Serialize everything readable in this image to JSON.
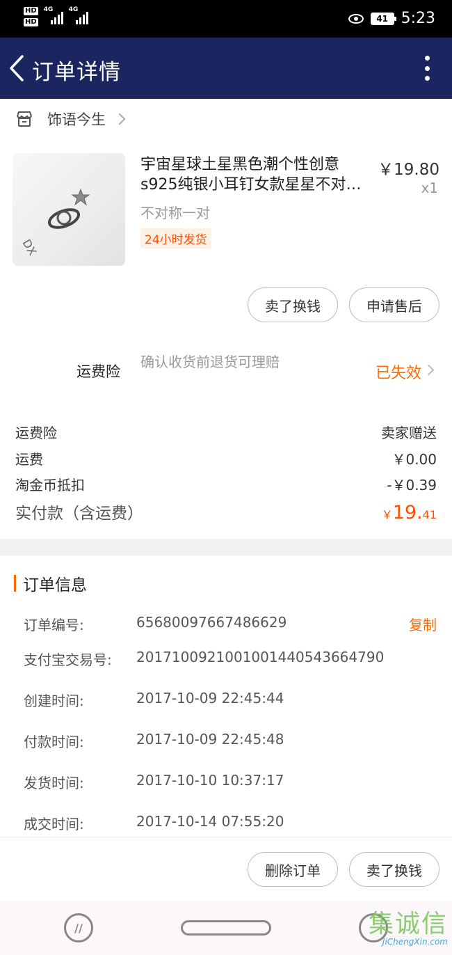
{
  "status_bar": {
    "hd_badges": [
      "HD",
      "HD"
    ],
    "network1": "4G",
    "network2": "4G",
    "battery": "41",
    "time": "5:23"
  },
  "header": {
    "title": "订单详情"
  },
  "shop": {
    "name": "饰语今生"
  },
  "product": {
    "title_line1": "宇宙星球土星黑色潮个性创意",
    "title_line2": "s925纯银小耳钉女款星星不对…",
    "price": "￥19.80",
    "quantity": "x1",
    "sku": "不对称一对",
    "tag": "24小时发货"
  },
  "product_actions": {
    "sell_label": "卖了换钱",
    "after_sale_label": "申请售后"
  },
  "insurance": {
    "label": "运费险",
    "description": "确认收货前退货可理赔",
    "status": "已失效"
  },
  "fees": [
    {
      "label": "运费险",
      "value": "卖家赠送"
    },
    {
      "label": "运费",
      "value": "￥0.00"
    },
    {
      "label": "淘金币抵扣",
      "value": "-￥0.39"
    }
  ],
  "total": {
    "label": "实付款（含运费）",
    "currency": "￥",
    "integer": "19.",
    "decimal": "41"
  },
  "order_info": {
    "heading": "订单信息",
    "copy_label": "复制",
    "rows": [
      {
        "label": "订单编号:",
        "value": "65680097667486629"
      },
      {
        "label": "支付宝交易号:",
        "value": "2017100921001001440543664790"
      },
      {
        "label": "创建时间:",
        "value": "2017-10-09 22:45:44"
      },
      {
        "label": "付款时间:",
        "value": "2017-10-09 22:45:48"
      },
      {
        "label": "发货时间:",
        "value": "2017-10-10 10:37:17"
      },
      {
        "label": "成交时间:",
        "value": "2017-10-14 07:55:20"
      }
    ]
  },
  "bottom_actions": {
    "delete_label": "删除订单",
    "sell_label": "卖了换钱"
  },
  "watermark": {
    "main": "集诚信",
    "sub": "JiChengXin.com"
  },
  "colors": {
    "navbar": "#1b2661",
    "accent": "#ff6a00",
    "price_red": "#ff5000"
  }
}
